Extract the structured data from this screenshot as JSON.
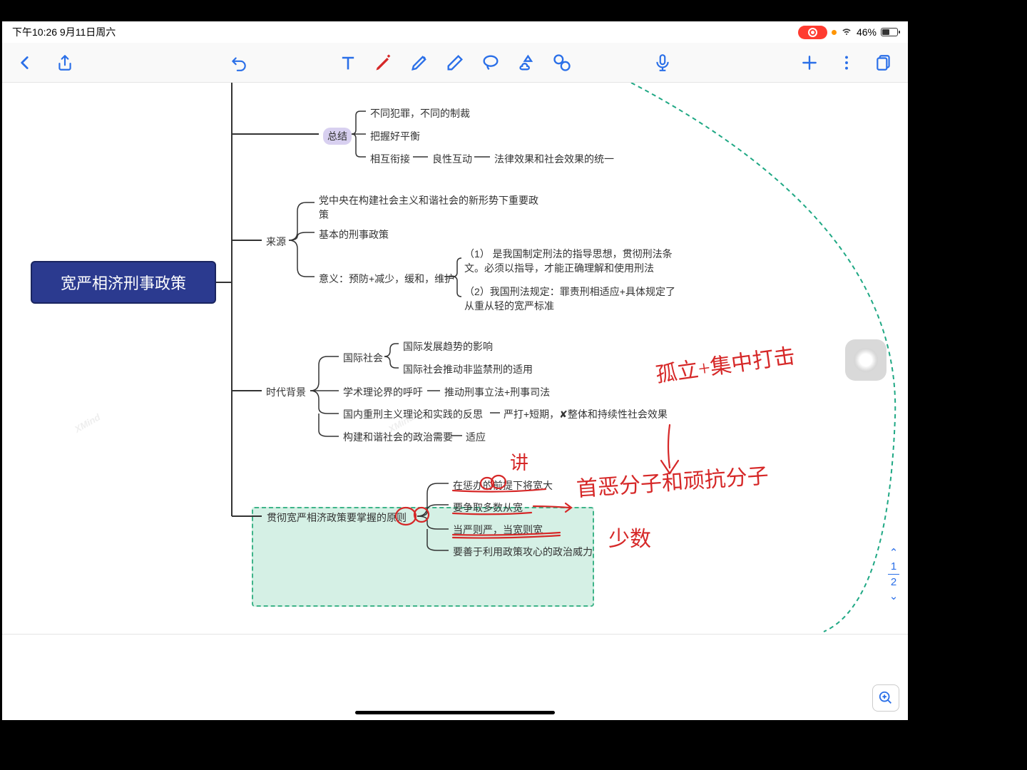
{
  "status": {
    "time_date": "下午10:26  9月11日周六",
    "battery": "46%"
  },
  "toolbar": {
    "tools": [
      "text",
      "pen",
      "highlighter",
      "eraser",
      "lasso",
      "shape",
      "ruler"
    ]
  },
  "pager": {
    "current": "1",
    "total": "2"
  },
  "mindmap": {
    "root": "宽严相济刑事政策",
    "b1": {
      "label": "总结",
      "c1": "不同犯罪，不同的制裁",
      "c2": "把握好平衡",
      "c3": {
        "label": "相互衔接",
        "d1": "良性互动",
        "e1": "法律效果和社会效果的统一"
      }
    },
    "b2": {
      "label": "来源",
      "c1": "党中央在构建社会主义和谐社会的新形势下重要政策",
      "c2": "基本的刑事政策",
      "c3": {
        "label": "意义：预防+减少，缓和，维护",
        "d1": "（1） 是我国制定刑法的指导思想，贯彻刑法条文。必须以指导，才能正确理解和使用刑法",
        "d2": "（2）我国刑法规定：罪责刑相适应+具体规定了从重从轻的宽严标准"
      }
    },
    "b3": {
      "label": "时代背景",
      "c1": {
        "label": "国际社会",
        "d1": "国际发展趋势的影响",
        "d2": "国际社会推动非监禁刑的适用"
      },
      "c2": {
        "label": "学术理论界的呼吁",
        "d1": "推动刑事立法+刑事司法"
      },
      "c3": {
        "label": "国内重刑主义理论和实践的反思",
        "d1": "严打+短期，✘整体和持续性社会效果"
      },
      "c4": {
        "label": "构建和谐社会的政治需要",
        "d1": "适应"
      }
    },
    "b4": {
      "label": "贯彻宽严相济政策要掌握的原则",
      "c1": "在惩办的前提下将宽大",
      "c2": "要争取多数从宽",
      "c3": "当严则严，当宽则宽",
      "c4": "要善于利用政策攻心的政治威力"
    }
  },
  "handwriting": {
    "h1": "孤立+集中打击",
    "h2": "首恶分子和顽抗分子",
    "h3": "少数",
    "h4": "讲"
  }
}
